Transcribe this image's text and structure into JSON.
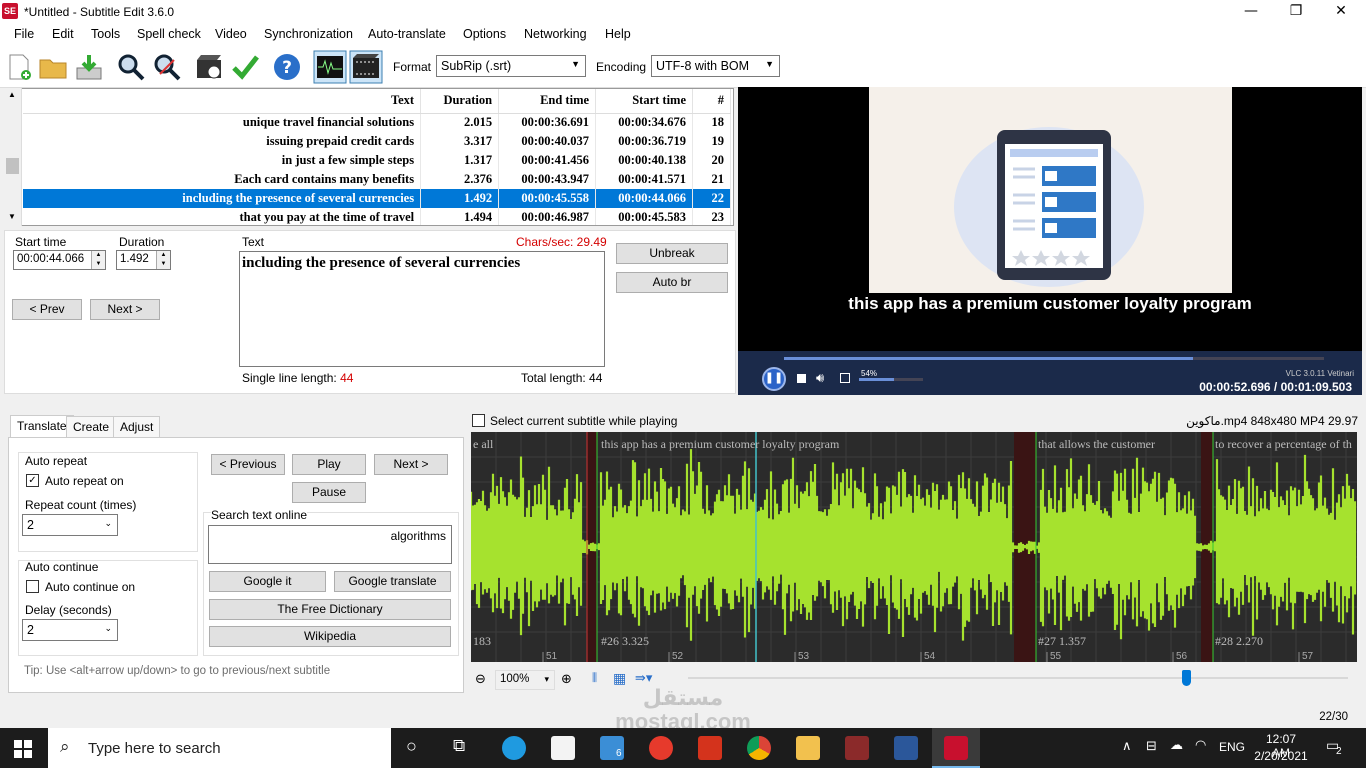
{
  "window": {
    "title": "*Untitled - Subtitle Edit 3.6.0",
    "icon_text": "SE",
    "minimize": "—",
    "maximize": "❐",
    "close": "✕"
  },
  "menu": [
    "File",
    "Edit",
    "Tools",
    "Spell check",
    "Video",
    "Synchronization",
    "Auto-translate",
    "Options",
    "Networking",
    "Help"
  ],
  "toolbar": {
    "format_label": "Format",
    "format_value": "SubRip (.srt)",
    "encoding_label": "Encoding",
    "encoding_value": "UTF-8 with BOM"
  },
  "grid": {
    "headers": [
      "Text",
      "Duration",
      "End time",
      "Start time",
      "#"
    ],
    "rows": [
      [
        "unique travel financial solutions",
        "2.015",
        "00:00:36.691",
        "00:00:34.676",
        "18"
      ],
      [
        "issuing prepaid credit cards",
        "3.317",
        "00:00:40.037",
        "00:00:36.719",
        "19"
      ],
      [
        "in just a few simple steps",
        "1.317",
        "00:00:41.456",
        "00:00:40.138",
        "20"
      ],
      [
        "Each card contains many benefits",
        "2.376",
        "00:00:43.947",
        "00:00:41.571",
        "21"
      ],
      [
        "including the presence of several currencies",
        "1.492",
        "00:00:45.558",
        "00:00:44.066",
        "22"
      ],
      [
        "that you pay at the time of travel",
        "1.494",
        "00:00:46.987",
        "00:00:45.583",
        "23"
      ]
    ]
  },
  "edit": {
    "start_label": "Start time",
    "start_value": "00:00:44.066",
    "duration_label": "Duration",
    "duration_value": "1.492",
    "text_label": "Text",
    "chars_sec": "Chars/sec: 29.49",
    "text_value": "including the presence of several currencies",
    "prev": "< Prev",
    "next": "Next >",
    "unbreak": "Unbreak",
    "autobr": "Auto br",
    "single_line": "Single line length: ",
    "single_line_value": "44",
    "total_length": "Total length: 44"
  },
  "video": {
    "subtitle": "this app has a premium customer loyalty program",
    "vlc_version": "VLC 3.0.11 Vetinari",
    "volume": "54%",
    "time": "00:00:52.696 / 00:01:09.503",
    "progress": 0.758
  },
  "tabs": [
    "Translate",
    "Create",
    "Adjust"
  ],
  "translate": {
    "auto_repeat": "Auto repeat",
    "auto_repeat_on": "Auto repeat on",
    "repeat_count": "Repeat count (times)",
    "repeat_value": "2",
    "auto_continue": "Auto continue",
    "auto_continue_on": "Auto continue on",
    "delay": "Delay (seconds)",
    "delay_value": "2",
    "previous": "< Previous",
    "play": "Play",
    "next": "Next >",
    "pause": "Pause",
    "search_online": "Search text online",
    "search_value": "algorithms",
    "google_it": "Google it",
    "google_translate": "Google translate",
    "free_dictionary": "The Free Dictionary",
    "wikipedia": "Wikipedia",
    "tip": "Tip: Use <alt+arrow up/down> to go to previous/next subtitle"
  },
  "waveform": {
    "select_current": "Select current subtitle while playing",
    "file_info": "ماكوين.mp4 848x480 MP4 29.97",
    "labels": [
      "e all",
      "this app has a premium customer loyalty program",
      "that allows the customer",
      "to recover a percentage of th"
    ],
    "markers": [
      "183",
      "#26  3.325",
      "#27  1.357",
      "#28  2.270"
    ],
    "ticks": [
      "51",
      "52",
      "53",
      "54",
      "55",
      "56",
      "57"
    ],
    "zoom": "100%"
  },
  "status": {
    "position": "22/30"
  },
  "taskbar": {
    "search": "Type here to search",
    "lang": "ENG",
    "time": "12:07 AM",
    "date": "2/20/2021",
    "notifications": "2",
    "mail_badge": "6"
  },
  "watermark": "مستقل mostaql.com",
  "colors": {
    "selection": "#0078d7",
    "wave": "#a6e22e",
    "chars_red": "#d40000"
  }
}
